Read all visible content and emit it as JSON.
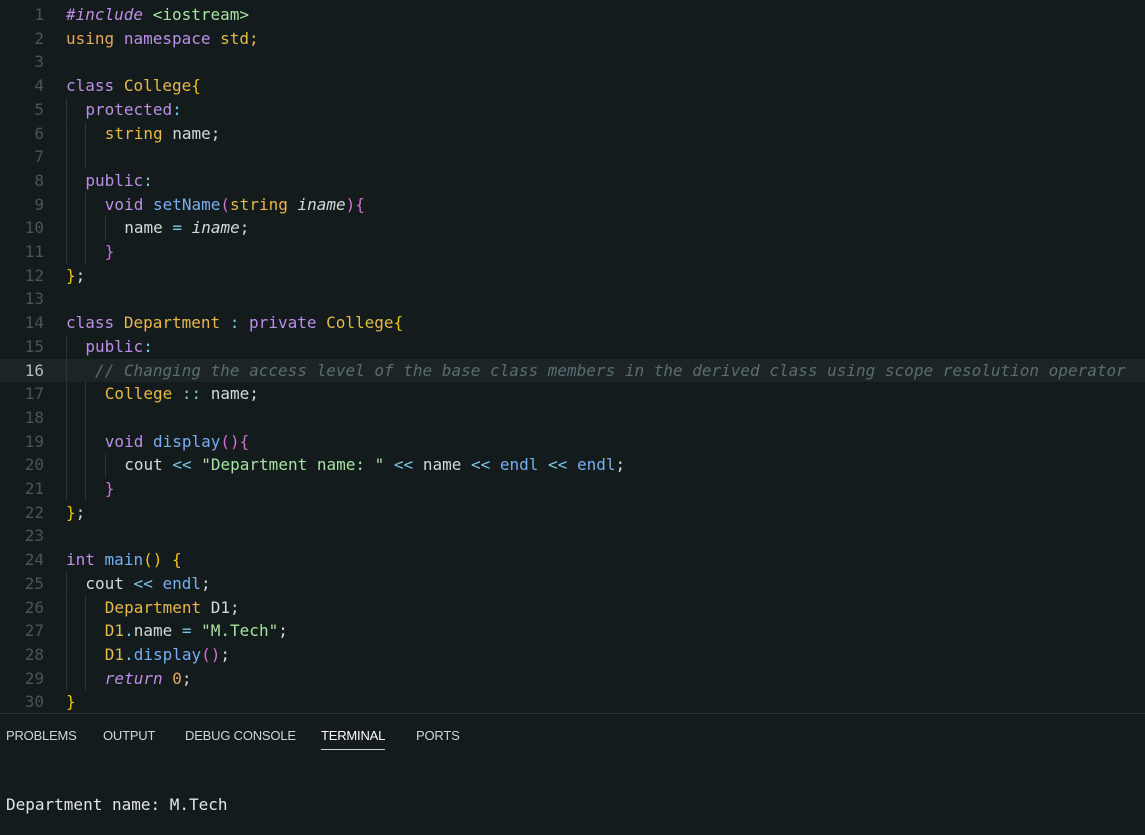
{
  "colors": {
    "background": "#141b1c",
    "keyword": "#bc8ee6",
    "type": "#e6b84a",
    "function": "#76aef0",
    "string": "#a6e3a1",
    "comment": "#5b6d70",
    "operator": "#7cc8e6",
    "bracket_gold": "#f1c40f",
    "bracket_pink": "#d070d0",
    "default": "#d4dadb",
    "line_number": "#46565a"
  },
  "editor": {
    "current_line": 16,
    "lines": [
      {
        "n": "1",
        "indent": 0,
        "tokens": [
          {
            "t": "#include",
            "c": "#bc8ee6",
            "i": true
          },
          {
            "t": " <iostream>",
            "c": "#a6e3a1"
          }
        ]
      },
      {
        "n": "2",
        "indent": 0,
        "tokens": [
          {
            "t": "using",
            "c": "#e6a85a"
          },
          {
            "t": " ",
            "c": ""
          },
          {
            "t": "namespace",
            "c": "#bc8ee6"
          },
          {
            "t": " std;",
            "c": "#e6b84a"
          }
        ]
      },
      {
        "n": "3",
        "indent": 0,
        "tokens": []
      },
      {
        "n": "4",
        "indent": 0,
        "tokens": [
          {
            "t": "class",
            "c": "#bc8ee6"
          },
          {
            "t": " ",
            "c": ""
          },
          {
            "t": "College",
            "c": "#e6b84a"
          },
          {
            "t": "{",
            "c": "#f1c40f"
          }
        ]
      },
      {
        "n": "5",
        "indent": 1,
        "tokens": [
          {
            "t": "protected",
            "c": "#bc8ee6"
          },
          {
            "t": ":",
            "c": "#7cc8e6"
          }
        ]
      },
      {
        "n": "6",
        "indent": 2,
        "tokens": [
          {
            "t": "string",
            "c": "#e6b84a"
          },
          {
            "t": " name;",
            "c": "#d4dadb"
          }
        ]
      },
      {
        "n": "7",
        "indent": 2,
        "tokens": []
      },
      {
        "n": "8",
        "indent": 1,
        "tokens": [
          {
            "t": "public",
            "c": "#bc8ee6"
          },
          {
            "t": ":",
            "c": "#7cc8e6"
          }
        ]
      },
      {
        "n": "9",
        "indent": 2,
        "tokens": [
          {
            "t": "void",
            "c": "#bc8ee6"
          },
          {
            "t": " ",
            "c": ""
          },
          {
            "t": "setName",
            "c": "#76aef0"
          },
          {
            "t": "(",
            "c": "#d070d0"
          },
          {
            "t": "string",
            "c": "#e6b84a"
          },
          {
            "t": " ",
            "c": ""
          },
          {
            "t": "iname",
            "c": "#d4dadb",
            "i": true
          },
          {
            "t": ")",
            "c": "#d070d0"
          },
          {
            "t": "{",
            "c": "#d070d0"
          }
        ]
      },
      {
        "n": "10",
        "indent": 3,
        "tokens": [
          {
            "t": "name",
            "c": "#d4dadb"
          },
          {
            "t": " = ",
            "c": "#7cc8e6"
          },
          {
            "t": "iname",
            "c": "#d4dadb",
            "i": true
          },
          {
            "t": ";",
            "c": "#d4dadb"
          }
        ]
      },
      {
        "n": "11",
        "indent": 2,
        "tokens": [
          {
            "t": "}",
            "c": "#d070d0"
          }
        ]
      },
      {
        "n": "12",
        "indent": 0,
        "tokens": [
          {
            "t": "}",
            "c": "#f1c40f"
          },
          {
            "t": ";",
            "c": "#d4dadb"
          }
        ]
      },
      {
        "n": "13",
        "indent": 0,
        "tokens": []
      },
      {
        "n": "14",
        "indent": 0,
        "tokens": [
          {
            "t": "class",
            "c": "#bc8ee6"
          },
          {
            "t": " ",
            "c": ""
          },
          {
            "t": "Department",
            "c": "#e6b84a"
          },
          {
            "t": " : ",
            "c": "#7cc8e6"
          },
          {
            "t": "private",
            "c": "#bc8ee6"
          },
          {
            "t": " ",
            "c": ""
          },
          {
            "t": "College",
            "c": "#e6b84a"
          },
          {
            "t": "{",
            "c": "#f1c40f"
          }
        ]
      },
      {
        "n": "15",
        "indent": 1,
        "tokens": [
          {
            "t": "public",
            "c": "#bc8ee6"
          },
          {
            "t": ":",
            "c": "#7cc8e6"
          }
        ]
      },
      {
        "n": "16",
        "indent": 1,
        "tokens": [
          {
            "t": " // Changing the access level of the base class members in the derived class using scope resolution operator",
            "c": "#5b6d70",
            "i": true
          }
        ]
      },
      {
        "n": "17",
        "indent": 2,
        "tokens": [
          {
            "t": "College",
            "c": "#e6b84a"
          },
          {
            "t": " :: ",
            "c": "#7cc8e6"
          },
          {
            "t": "name;",
            "c": "#d4dadb"
          }
        ]
      },
      {
        "n": "18",
        "indent": 2,
        "tokens": []
      },
      {
        "n": "19",
        "indent": 2,
        "tokens": [
          {
            "t": "void",
            "c": "#bc8ee6"
          },
          {
            "t": " ",
            "c": ""
          },
          {
            "t": "display",
            "c": "#76aef0"
          },
          {
            "t": "()",
            "c": "#d070d0"
          },
          {
            "t": "{",
            "c": "#d070d0"
          }
        ]
      },
      {
        "n": "20",
        "indent": 3,
        "tokens": [
          {
            "t": "cout",
            "c": "#d4dadb"
          },
          {
            "t": " << ",
            "c": "#7cc8e6"
          },
          {
            "t": "\"Department name: \"",
            "c": "#a6e3a1"
          },
          {
            "t": " << ",
            "c": "#7cc8e6"
          },
          {
            "t": "name",
            "c": "#d4dadb"
          },
          {
            "t": " << ",
            "c": "#7cc8e6"
          },
          {
            "t": "endl",
            "c": "#76aef0"
          },
          {
            "t": " << ",
            "c": "#7cc8e6"
          },
          {
            "t": "endl",
            "c": "#76aef0"
          },
          {
            "t": ";",
            "c": "#d4dadb"
          }
        ]
      },
      {
        "n": "21",
        "indent": 2,
        "tokens": [
          {
            "t": "}",
            "c": "#d070d0"
          }
        ]
      },
      {
        "n": "22",
        "indent": 0,
        "tokens": [
          {
            "t": "}",
            "c": "#f1c40f"
          },
          {
            "t": ";",
            "c": "#d4dadb"
          }
        ]
      },
      {
        "n": "23",
        "indent": 0,
        "tokens": []
      },
      {
        "n": "24",
        "indent": 0,
        "tokens": [
          {
            "t": "int",
            "c": "#bc8ee6"
          },
          {
            "t": " ",
            "c": ""
          },
          {
            "t": "main",
            "c": "#76aef0"
          },
          {
            "t": "()",
            "c": "#f1c40f"
          },
          {
            "t": " ",
            "c": ""
          },
          {
            "t": "{",
            "c": "#f1c40f"
          }
        ]
      },
      {
        "n": "25",
        "indent": 1,
        "tokens": [
          {
            "t": "cout",
            "c": "#d4dadb"
          },
          {
            "t": " << ",
            "c": "#7cc8e6"
          },
          {
            "t": "endl",
            "c": "#76aef0"
          },
          {
            "t": ";",
            "c": "#d4dadb"
          }
        ]
      },
      {
        "n": "26",
        "indent": 2,
        "tokens": [
          {
            "t": "Department",
            "c": "#e6b84a"
          },
          {
            "t": " D1;",
            "c": "#d4dadb"
          }
        ]
      },
      {
        "n": "27",
        "indent": 2,
        "tokens": [
          {
            "t": "D1",
            "c": "#e6b84a"
          },
          {
            "t": ".",
            "c": "#7cc8e6"
          },
          {
            "t": "name",
            "c": "#d4dadb"
          },
          {
            "t": " = ",
            "c": "#7cc8e6"
          },
          {
            "t": "\"M.Tech\"",
            "c": "#a6e3a1"
          },
          {
            "t": ";",
            "c": "#d4dadb"
          }
        ]
      },
      {
        "n": "28",
        "indent": 2,
        "tokens": [
          {
            "t": "D1",
            "c": "#e6b84a"
          },
          {
            "t": ".",
            "c": "#7cc8e6"
          },
          {
            "t": "display",
            "c": "#76aef0"
          },
          {
            "t": "()",
            "c": "#d070d0"
          },
          {
            "t": ";",
            "c": "#d4dadb"
          }
        ]
      },
      {
        "n": "29",
        "indent": 2,
        "tokens": [
          {
            "t": "return",
            "c": "#bc8ee6",
            "i": true
          },
          {
            "t": " ",
            "c": ""
          },
          {
            "t": "0",
            "c": "#e6a85a"
          },
          {
            "t": ";",
            "c": "#d4dadb"
          }
        ]
      },
      {
        "n": "30",
        "indent": 0,
        "tokens": [
          {
            "t": "}",
            "c": "#f1c40f"
          }
        ]
      }
    ]
  },
  "panel": {
    "tabs": [
      {
        "label": "PROBLEMS",
        "active": false
      },
      {
        "label": "OUTPUT",
        "active": false
      },
      {
        "label": "DEBUG CONSOLE",
        "active": false
      },
      {
        "label": "TERMINAL",
        "active": true
      },
      {
        "label": "PORTS",
        "active": false
      }
    ],
    "terminal_output": "Department name: M.Tech"
  }
}
